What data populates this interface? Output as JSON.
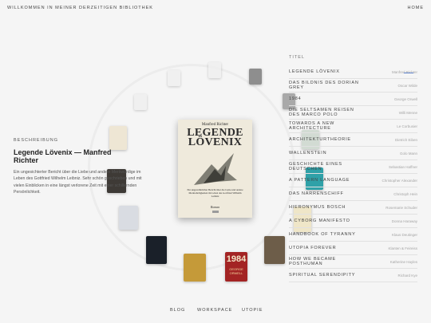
{
  "header": {
    "welcome": "WILLKOMMEN IN MEINER DERZEITIGEN BIBLIOTHEK",
    "home": "HOME"
  },
  "featured": {
    "cover_author": "Manfred Richter",
    "cover_title": "LEGENDE LÖVENIX",
    "cover_blurb": "Ein ungewöhnlicher Bericht über die Liebe und andere Merkwürdigkeiten im Leben des Gottfried Wilhelm Leibniz",
    "cover_genre": "Roman"
  },
  "description": {
    "heading": "BESCHREIBUNG",
    "title": "Legende Lövenix — Manfred Richter",
    "text": "Ein ungesichterter Bericht über die Liebe und andere Merkwürdige im Leben des Gottfried Wilhelm Leibniz. Sehr schön geschrieben und mit vielen Einblicken in eine längst verlorene Zeit mit einer schillernden Persönlichkeit."
  },
  "list": {
    "heading": "TITEL",
    "books": [
      {
        "title": "Legende Lövenix",
        "author": "Manfred Richter"
      },
      {
        "title": "Das Bildnis des Dorian Grey",
        "author": "Oscar Wilde"
      },
      {
        "title": "1984",
        "author": "George Orwell"
      },
      {
        "title": "Die seltsamen Reisen des Marco Polo",
        "author": "Willi Menne"
      },
      {
        "title": "Towards a new architecture",
        "author": "Le Corbusier"
      },
      {
        "title": "Architekturtheorie",
        "author": "Dietrich Eiben"
      },
      {
        "title": "Wallenstein",
        "author": "Golo Mann"
      },
      {
        "title": "Geschichte eines Deutschen",
        "author": "Sebastian Haffner"
      },
      {
        "title": "A pattern language",
        "author": "Christopher Alexander"
      },
      {
        "title": "Das Narrenschiff",
        "author": "Christoph Hein"
      },
      {
        "title": "Hieronymus Bosch",
        "author": "Rosemarie Schuder"
      },
      {
        "title": "A Cyborg Manifesto",
        "author": "Donna Haraway"
      },
      {
        "title": "Handbook of Tyranny",
        "author": "Klaus Deutinger"
      },
      {
        "title": "Utopia Forever",
        "author": "Klanten & Feireiss"
      },
      {
        "title": "How we became posthuman",
        "author": "Katherine Hayles"
      },
      {
        "title": "Spiritual Serendipity",
        "author": "Richard Kye"
      }
    ]
  },
  "ring_covers": {
    "orwell_line1": "1984",
    "orwell_line2": "GEORGE",
    "orwell_line3": "ORWELL"
  },
  "footer": {
    "blog": "BLOG",
    "workspace": "WORKSPACE",
    "utopie": "UTOPIE"
  }
}
